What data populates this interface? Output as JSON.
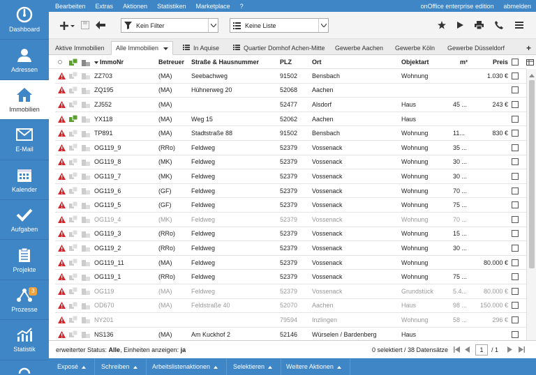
{
  "sidebar": {
    "items": [
      {
        "label": "Dashboard",
        "icon": "dashboard-icon"
      },
      {
        "label": "Adressen",
        "icon": "person-icon"
      },
      {
        "label": "Immobilien",
        "icon": "house-icon",
        "active": true
      },
      {
        "label": "E-Mail",
        "icon": "envelope-icon"
      },
      {
        "label": "Kalender",
        "icon": "calendar-icon"
      },
      {
        "label": "Aufgaben",
        "icon": "checkmark-icon"
      },
      {
        "label": "Projekte",
        "icon": "clipboard-icon"
      },
      {
        "label": "Prozesse",
        "icon": "process-icon",
        "badge": "3"
      },
      {
        "label": "Statistik",
        "icon": "chart-icon"
      }
    ]
  },
  "topmenu": {
    "items": [
      "Bearbeiten",
      "Extras",
      "Aktionen",
      "Statistiken",
      "Marketplace",
      "?"
    ],
    "edition": "onOffice enterprise edition",
    "logout": "abmelden"
  },
  "toolbar": {
    "filter": "Kein Filter",
    "list": "Keine Liste"
  },
  "tabs": [
    "Aktive Immobilien",
    "Alle Immobilien",
    "In Aquise",
    "Quartier Domhof Achen-Mitte",
    "Gewerbe Aachen",
    "Gewerbe Köln",
    "Gewerbe Düsseldorf"
  ],
  "table": {
    "headers": {
      "immonr": "ImmoNr",
      "betreuer": "Betreuer",
      "strasse": "Straße & Hausnummer",
      "plz": "PLZ",
      "ort": "Ort",
      "objektart": "Objektart",
      "m2": "m²",
      "preis": "Preis"
    },
    "rows": [
      {
        "warn": true,
        "green": false,
        "nr": "ZZ703",
        "betreuer": "(MA)",
        "strasse": "Seebachweg",
        "plz": "91502",
        "ort": "Bensbach",
        "objektart": "Wohnung",
        "m2": "",
        "preis": "1.030 €",
        "inactive": false
      },
      {
        "warn": true,
        "green": false,
        "nr": "ZQ195",
        "betreuer": "(MA)",
        "strasse": "Hühnerweg 20",
        "plz": "52068",
        "ort": "Aachen",
        "objektart": "",
        "m2": "",
        "preis": "",
        "inactive": false
      },
      {
        "warn": true,
        "green": false,
        "nr": "ZJ552",
        "betreuer": "(MA)",
        "strasse": "",
        "plz": "52477",
        "ort": "Alsdorf",
        "objektart": "Haus",
        "m2": "45 ...",
        "preis": "243 €",
        "inactive": false
      },
      {
        "warn": true,
        "green": true,
        "nr": "YX118",
        "betreuer": "(MA)",
        "strasse": "Weg 15",
        "plz": "52062",
        "ort": "Aachen",
        "objektart": "Haus",
        "m2": "",
        "preis": "",
        "inactive": false
      },
      {
        "warn": true,
        "green": false,
        "nr": "TP891",
        "betreuer": "(MA)",
        "strasse": "Stadtstraße 88",
        "plz": "91502",
        "ort": "Bensbach",
        "objektart": "Wohnung",
        "m2": "11...",
        "preis": "830 €",
        "inactive": false
      },
      {
        "warn": true,
        "green": false,
        "nr": "OG119_9",
        "betreuer": "(RRo)",
        "strasse": "Feldweg",
        "plz": "52379",
        "ort": "Vossenack",
        "objektart": "Wohnung",
        "m2": "35 ...",
        "preis": "",
        "inactive": false
      },
      {
        "warn": true,
        "green": false,
        "nr": "OG119_8",
        "betreuer": "(MK)",
        "strasse": "Feldweg",
        "plz": "52379",
        "ort": "Vossenack",
        "objektart": "Wohnung",
        "m2": "30 ...",
        "preis": "",
        "inactive": false
      },
      {
        "warn": true,
        "green": false,
        "nr": "OG119_7",
        "betreuer": "(MK)",
        "strasse": "Feldweg",
        "plz": "52379",
        "ort": "Vossenack",
        "objektart": "Wohnung",
        "m2": "30 ...",
        "preis": "",
        "inactive": false
      },
      {
        "warn": true,
        "green": false,
        "nr": "OG119_6",
        "betreuer": "(GF)",
        "strasse": "Feldweg",
        "plz": "52379",
        "ort": "Vossenack",
        "objektart": "Wohnung",
        "m2": "70 ...",
        "preis": "",
        "inactive": false
      },
      {
        "warn": true,
        "green": false,
        "nr": "OG119_5",
        "betreuer": "(GF)",
        "strasse": "Feldweg",
        "plz": "52379",
        "ort": "Vossenack",
        "objektart": "Wohnung",
        "m2": "75 ...",
        "preis": "",
        "inactive": false
      },
      {
        "warn": true,
        "green": false,
        "nr": "OG119_4",
        "betreuer": "(MK)",
        "strasse": "Feldweg",
        "plz": "52379",
        "ort": "Vossenack",
        "objektart": "Wohnung",
        "m2": "70 ...",
        "preis": "",
        "inactive": true
      },
      {
        "warn": true,
        "green": false,
        "nr": "OG119_3",
        "betreuer": "(RRo)",
        "strasse": "Feldweg",
        "plz": "52379",
        "ort": "Vossenack",
        "objektart": "Wohnung",
        "m2": "15 ...",
        "preis": "",
        "inactive": false
      },
      {
        "warn": true,
        "green": false,
        "nr": "OG119_2",
        "betreuer": "(RRo)",
        "strasse": "Feldweg",
        "plz": "52379",
        "ort": "Vossenack",
        "objektart": "Wohnung",
        "m2": "30 ...",
        "preis": "",
        "inactive": false
      },
      {
        "warn": true,
        "green": false,
        "nr": "OG119_11",
        "betreuer": "(MA)",
        "strasse": "Feldweg",
        "plz": "52379",
        "ort": "Vossenack",
        "objektart": "Wohnung",
        "m2": "",
        "preis": "80.000 €",
        "inactive": false
      },
      {
        "warn": true,
        "green": false,
        "nr": "OG119_1",
        "betreuer": "(RRo)",
        "strasse": "Feldweg",
        "plz": "52379",
        "ort": "Vossenack",
        "objektart": "Wohnung",
        "m2": "75 ...",
        "preis": "",
        "inactive": false
      },
      {
        "warn": true,
        "green": false,
        "nr": "OG119",
        "betreuer": "(MA)",
        "strasse": "Feldweg",
        "plz": "52379",
        "ort": "Vossenack",
        "objektart": "Grundstück",
        "m2": "5.4...",
        "preis": "80.000 €",
        "inactive": true
      },
      {
        "warn": true,
        "green": false,
        "nr": "OD670",
        "betreuer": "(MA)",
        "strasse": "Feldstraße 40",
        "plz": "52070",
        "ort": "Aachen",
        "objektart": "Haus",
        "m2": "98 ...",
        "preis": "150.000 €",
        "inactive": true
      },
      {
        "warn": true,
        "green": false,
        "nr": "NY201",
        "betreuer": "",
        "strasse": "",
        "plz": "79594",
        "ort": "Inzlingen",
        "objektart": "Wohnung",
        "m2": "58 ...",
        "preis": "296 €",
        "inactive": true
      },
      {
        "warn": true,
        "green": false,
        "nr": "NS136",
        "betreuer": "(MA)",
        "strasse": "Am Kuckhof 2",
        "plz": "52146",
        "ort": "Würselen / Bardenberg",
        "objektart": "Haus",
        "m2": "",
        "preis": "",
        "inactive": false
      }
    ]
  },
  "status": {
    "label": "erweiterter Status:",
    "status_value": "Alle",
    "units_label": ", Einheiten anzeigen:",
    "units_value": "ja",
    "count": "0 selektiert / 38 Datensätze",
    "page": "1",
    "pages": "/ 1"
  },
  "bottombar": [
    "Exposé",
    "Schreiben",
    "Arbeitslistenaktionen",
    "Selektieren",
    "Weitere Aktionen"
  ]
}
